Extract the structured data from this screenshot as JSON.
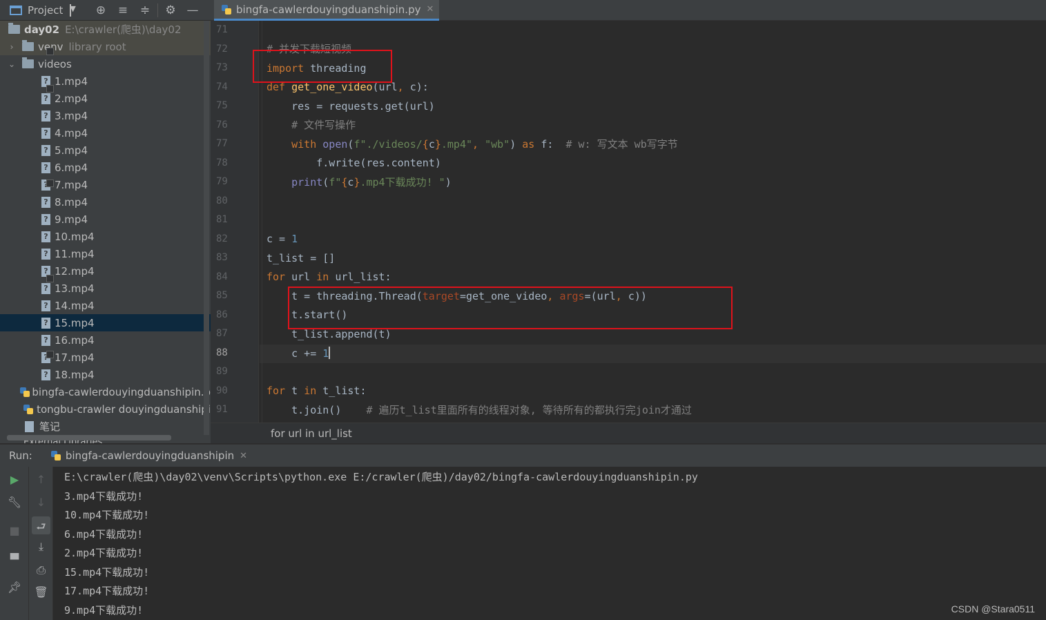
{
  "project_toolbar": {
    "title": "Project"
  },
  "tree": {
    "root": {
      "name": "day02",
      "path": "E:\\crawler(爬虫)\\day02"
    },
    "venv": {
      "name": "venv",
      "hint": "library root"
    },
    "videos": {
      "name": "videos"
    },
    "files": [
      "1.mp4",
      "2.mp4",
      "3.mp4",
      "4.mp4",
      "5.mp4",
      "6.mp4",
      "7.mp4",
      "8.mp4",
      "9.mp4",
      "10.mp4",
      "11.mp4",
      "12.mp4",
      "13.mp4",
      "14.mp4",
      "15.mp4",
      "16.mp4",
      "17.mp4",
      "18.mp4"
    ],
    "selected_file": "15.mp4",
    "py_files": [
      "bingfa-cawlerdouyingduanshipin.p",
      "tongbu-crawler douyingduanshipi"
    ],
    "note": "笔记",
    "external": "External Libraries"
  },
  "editor": {
    "tab_title": "bingfa-cawlerdouyingduanshipin.py",
    "line_numbers": [
      "71",
      "72",
      "73",
      "74",
      "75",
      "76",
      "77",
      "78",
      "79",
      "80",
      "81",
      "82",
      "83",
      "84",
      "85",
      "86",
      "87",
      "88",
      "89",
      "90",
      "91"
    ],
    "current_line": "88"
  },
  "code": {
    "l72_comment": "# 并发下载短视频",
    "l73_kw": "import",
    "l73_mod": " threading",
    "l74_def": "def",
    "l74_fn": "get_one_video",
    "l74_args_a": "(url",
    "l74_args_b": ", ",
    "l74_args_c": "c):",
    "l75": "    res = requests.get(url)",
    "l76_comment": "    # 文件写操作",
    "l77_with": "    with",
    "l77_open": " open",
    "l77_paren": "(",
    "l77_fstr_a": "f\"./videos/",
    "l77_brace_open": "{",
    "l77_c": "c",
    "l77_brace_close": "}",
    "l77_fstr_b": ".mp4\"",
    "l77_comma": ", ",
    "l77_wb": "\"wb\"",
    "l77_close": ") ",
    "l77_as": "as",
    "l77_f": " f:  ",
    "l77_comment": "# w: 写文本 wb写字节",
    "l78": "        f.write(res.content)",
    "l79_print": "    print",
    "l79_paren": "(",
    "l79_fstr_a": "f\"",
    "l79_brace_open": "{",
    "l79_c": "c",
    "l79_brace_close": "}",
    "l79_fstr_b": ".mp4下载成功! \"",
    "l79_close": ")",
    "l82_a": "c = ",
    "l82_num": "1",
    "l83": "t_list = []",
    "l84_for": "for",
    "l84_a": " url ",
    "l84_in": "in",
    "l84_b": " url_list:",
    "l85_a": "    t = threading.Thread(",
    "l85_target": "target",
    "l85_b": "=get_one_video",
    "l85_comma": ", ",
    "l85_args": "args",
    "l85_c": "=(url",
    "l85_comma2": ", ",
    "l85_d": "c))",
    "l86": "    t.start()",
    "l87": "    t_list.append(t)",
    "l88_a": "    c += ",
    "l88_num": "1",
    "l90_for": "for",
    "l90_a": " t ",
    "l90_in": "in",
    "l90_b": " t_list:",
    "l91_a": "    t.join()    ",
    "l91_comment": "# 遍历t_list里面所有的线程对象, 等待所有的都执行完join才通过"
  },
  "breadcrumb": "for url in url_list",
  "run": {
    "label": "Run:",
    "tab_title": "bingfa-cawlerdouyingduanshipin",
    "output": [
      "E:\\crawler(爬虫)\\day02\\venv\\Scripts\\python.exe E:/crawler(爬虫)/day02/bingfa-cawlerdouyingduanshipin.py",
      "3.mp4下载成功!",
      "10.mp4下载成功!",
      "6.mp4下载成功!",
      "2.mp4下载成功!",
      "15.mp4下载成功!",
      "17.mp4下载成功!",
      "9.mp4下载成功!"
    ]
  },
  "watermark": "CSDN @Stara0511",
  "colors": {
    "keyword": "#cc7832",
    "function": "#ffc66d",
    "string": "#6a8759",
    "number": "#6897bb",
    "comment": "#808080",
    "highlight_box": "#e0121b",
    "selection": "#0d293e"
  }
}
